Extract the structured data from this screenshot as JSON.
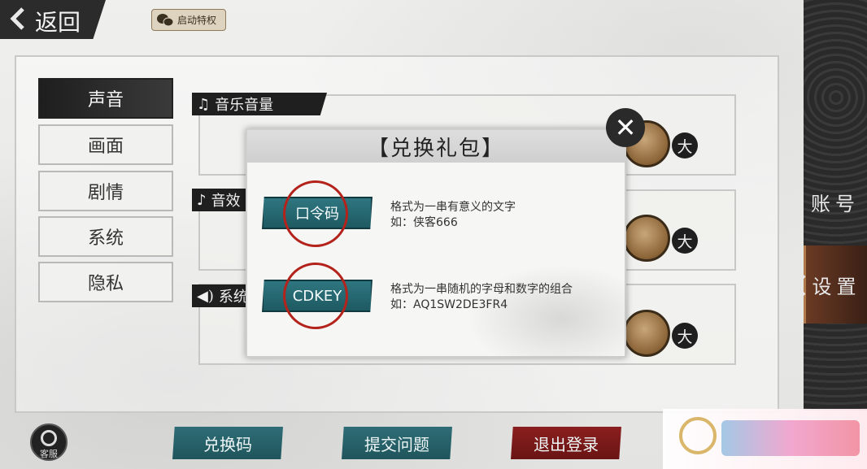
{
  "header": {
    "back_label": "返回",
    "privilege_label": "启动特权"
  },
  "sidebar": {
    "items": [
      {
        "label": "声音",
        "active": true
      },
      {
        "label": "画面",
        "active": false
      },
      {
        "label": "剧情",
        "active": false
      },
      {
        "label": "系统",
        "active": false
      },
      {
        "label": "隐私",
        "active": false
      }
    ]
  },
  "sections": [
    {
      "label": "音乐音量",
      "icon": "music-note-icon",
      "max_label": "大"
    },
    {
      "label": "音效",
      "icon": "music-note-icon",
      "max_label": "大"
    },
    {
      "label": "系统",
      "icon": "speaker-icon",
      "max_label": "大"
    }
  ],
  "right_nav": {
    "items": [
      {
        "label": "账号",
        "active": false
      },
      {
        "label": "设置",
        "active": true
      }
    ]
  },
  "modal": {
    "title": "【兑换礼包】",
    "options": [
      {
        "button_label": "口令码",
        "description_line1": "格式为一串有意义的文字",
        "description_line2": "如：侠客666"
      },
      {
        "button_label": "CDKEY",
        "description_line1": "格式为一串随机的字母和数字的组合",
        "description_line2": "如：AQ1SW2DE3FR4"
      }
    ],
    "close_icon": "close-icon"
  },
  "bottom_bar": {
    "support_label": "客服",
    "redeem_label": "兑换码",
    "submit_issue_label": "提交问题",
    "logout_label": "退出登录"
  },
  "colors": {
    "teal_button": "#2f6d76",
    "logout_button": "#8b1f1f",
    "highlight_ring": "#b4231b"
  }
}
